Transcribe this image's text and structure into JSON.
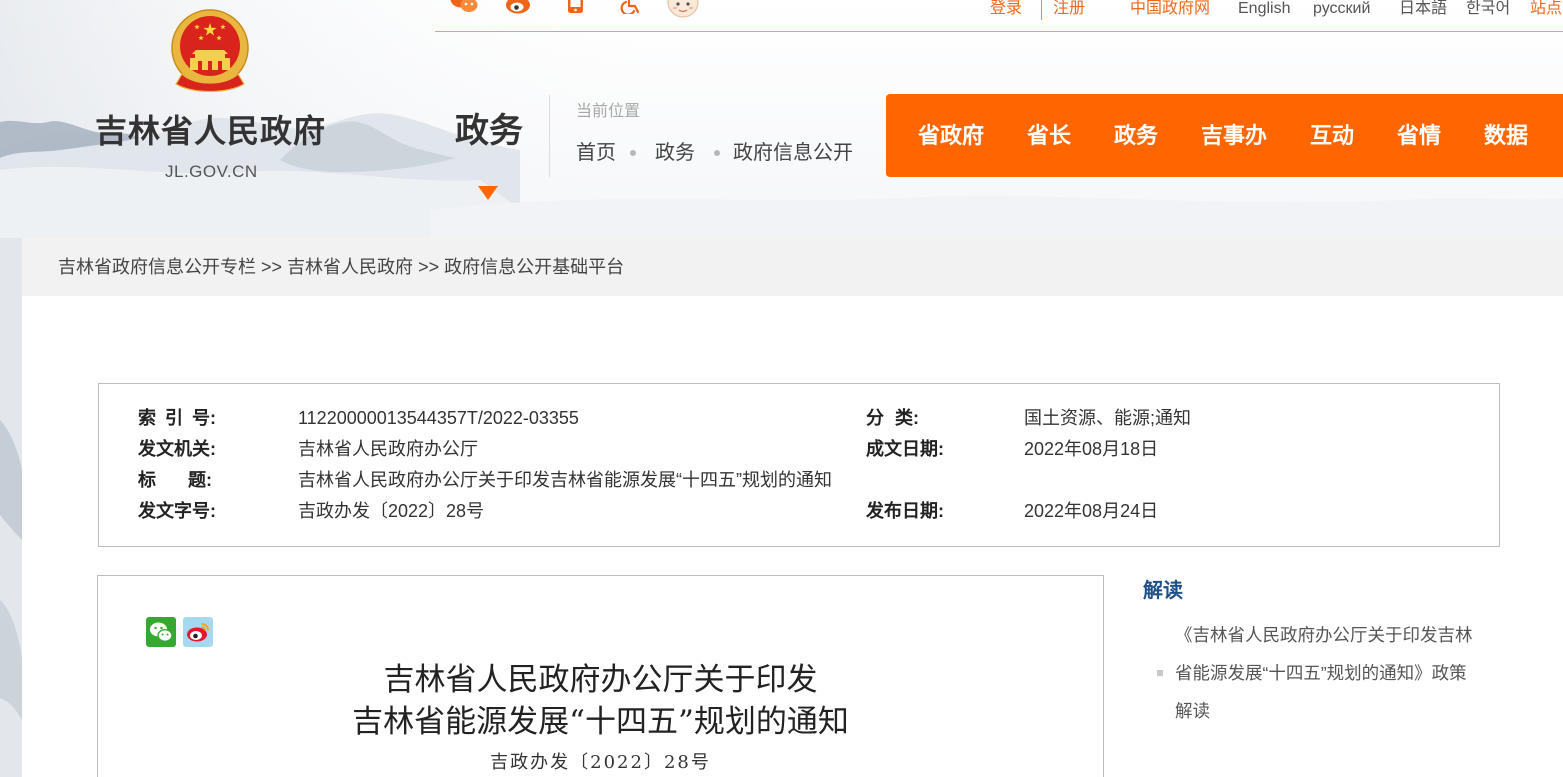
{
  "colors": {
    "brand_orange": "#ff6600",
    "link_orange": "#ec6a1c",
    "heading_blue": "#1f5187",
    "panel_gray": "#f2f2f2"
  },
  "top_bar": {
    "icons": [
      "wechat-icon",
      "weibo-icon",
      "mobile-icon",
      "accessibility-icon",
      "elder-mode-icon"
    ],
    "login": "登录",
    "register": "注册",
    "gov_portal": "中国政府网",
    "languages": [
      "English",
      "русский",
      "日本語",
      "한국어"
    ],
    "site_nav": "站点"
  },
  "header": {
    "emblem": "national-emblem-icon",
    "site_name": "吉林省人民政府",
    "domain": "JL.GOV.CN",
    "channel": "政务",
    "location_label": "当前位置",
    "location": [
      "首页",
      "政务",
      "政府信息公开"
    ]
  },
  "main_nav": [
    "省政府",
    "省长",
    "政务",
    "吉事办",
    "互动",
    "省情",
    "数据"
  ],
  "breadcrumb": {
    "items": [
      "吉林省政府信息公开专栏",
      "吉林省人民政府",
      "政府信息公开基础平台"
    ],
    "separator": ">>"
  },
  "info": {
    "rows": [
      {
        "label": "索 引 号:",
        "value": "11220000013544357T/2022-03355",
        "label2": "分 类:",
        "value2": "国土资源、能源;通知"
      },
      {
        "label": "发文机关:",
        "value": "吉林省人民政府办公厅",
        "label2": "成文日期:",
        "value2": "2022年08月18日"
      },
      {
        "label": "标 题:",
        "value": "吉林省人民政府办公厅关于印发吉林省能源发展“十四五”规划的通知"
      },
      {
        "label": "发文字号:",
        "value": "吉政办发〔2022〕28号",
        "label2": "发布日期:",
        "value2": "2022年08月24日"
      }
    ]
  },
  "article": {
    "share_icons": [
      "wechat-share-icon",
      "weibo-share-icon"
    ],
    "title_lines": [
      "吉林省人民政府办公厅关于印发",
      "吉林省能源发展“十四五”规划的通知"
    ],
    "doc_number": "吉政办发〔2022〕28号"
  },
  "sidebar": {
    "heading": "解读",
    "items": [
      "《吉林省人民政府办公厅关于印发吉林省能源发展“十四五”规划的通知》政策解读"
    ]
  }
}
